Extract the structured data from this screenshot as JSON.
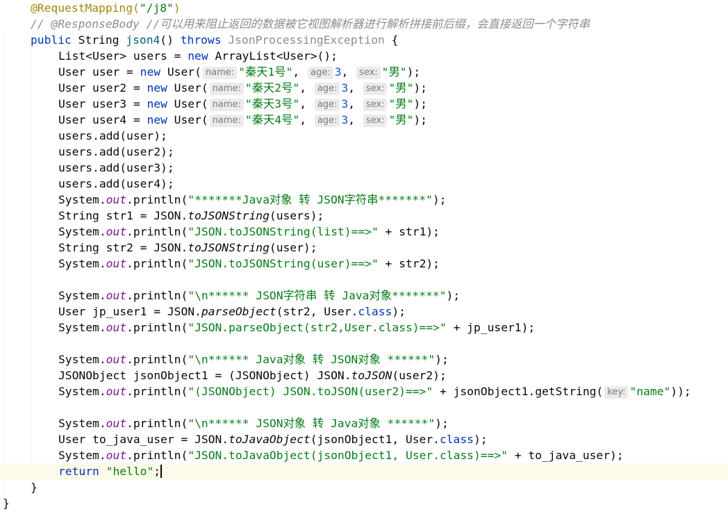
{
  "colors": {
    "keyword": "#0033b3",
    "string": "#067d17",
    "number": "#1750eb",
    "annotation": "#9e880d",
    "comment": "#8c8c8c",
    "static_field": "#871094",
    "method_name": "#00627a",
    "current_line": "#fcfae9",
    "hint_bg": "#ebebeb"
  },
  "code": {
    "l1": {
      "ann": "@RequestMapping(",
      "str": "\"/j8\"",
      "close": ")"
    },
    "l2": {
      "comment": "// @ResponseBody //可以用来阻止返回的数据被它视图解析器进行解析拼接前后缀，会直接返回一个字符串"
    },
    "l3": {
      "kw1": "public",
      "type": "String",
      "name": "json4",
      "parens": "()",
      "kw2": "throws",
      "exc": "JsonProcessingException",
      "brace": "{"
    },
    "l4": {
      "text1": "List<User> users = ",
      "kw": "new",
      "text2": " ArrayList<User>();"
    },
    "l5": {
      "prefix": "User user = ",
      "kw": "new",
      "ctor": " User(",
      "hint_name": "name:",
      "str_name": "\"秦天1号\"",
      "hint_age": "age:",
      "age": "3",
      "hint_sex": "sex:",
      "str_sex": "\"男\"",
      "end": ");"
    },
    "l6": {
      "prefix": "User user2 = ",
      "kw": "new",
      "ctor": " User(",
      "hint_name": "name:",
      "str_name": "\"秦天2号\"",
      "hint_age": "age:",
      "age": "3",
      "hint_sex": "sex:",
      "str_sex": "\"男\"",
      "end": ");"
    },
    "l7": {
      "prefix": "User user3 = ",
      "kw": "new",
      "ctor": " User(",
      "hint_name": "name:",
      "str_name": "\"秦天3号\"",
      "hint_age": "age:",
      "age": "3",
      "hint_sex": "sex:",
      "str_sex": "\"男\"",
      "end": ");"
    },
    "l8": {
      "prefix": "User user4 = ",
      "kw": "new",
      "ctor": " User(",
      "hint_name": "name:",
      "str_name": "\"秦天4号\"",
      "hint_age": "age:",
      "age": "3",
      "hint_sex": "sex:",
      "str_sex": "\"男\"",
      "end": ");"
    },
    "l9": {
      "text": "users.add(user);"
    },
    "l10": {
      "text": "users.add(user2);"
    },
    "l11": {
      "text": "users.add(user3);"
    },
    "l12": {
      "text": "users.add(user4);"
    },
    "l13": {
      "sys": "System.",
      "out": "out",
      "println": ".println(",
      "str": "\"*******Java对象 转 JSON字符串*******\"",
      "end": ");"
    },
    "l14": {
      "prefix": "String str1 = JSON.",
      "method": "toJSONString",
      "end": "(users);"
    },
    "l15": {
      "sys": "System.",
      "out": "out",
      "println": ".println(",
      "str": "\"JSON.toJSONString(list)==>\"",
      "end": " + str1);"
    },
    "l16": {
      "prefix": "String str2 = JSON.",
      "method": "toJSONString",
      "end": "(user);"
    },
    "l17": {
      "sys": "System.",
      "out": "out",
      "println": ".println(",
      "str": "\"JSON.toJSONString(user)==>\"",
      "end": " + str2);"
    },
    "l19": {
      "sys": "System.",
      "out": "out",
      "println": ".println(",
      "str": "\"\\n****** JSON字符串 转 Java对象*******\"",
      "end": ");"
    },
    "l20": {
      "prefix": "User jp_user1 = JSON.",
      "method": "parseObject",
      "mid": "(str2, User.",
      "kw": "class",
      "end": ");"
    },
    "l21": {
      "sys": "System.",
      "out": "out",
      "println": ".println(",
      "str": "\"JSON.parseObject(str2,User.class)==>\"",
      "end": " + jp_user1);"
    },
    "l23": {
      "sys": "System.",
      "out": "out",
      "println": ".println(",
      "str": "\"\\n****** Java对象 转 JSON对象 ******\"",
      "end": ");"
    },
    "l24": {
      "prefix": "JSONObject jsonObject1 = (JSONObject) JSON.",
      "method": "toJSON",
      "end": "(user2);"
    },
    "l25": {
      "sys": "System.",
      "out": "out",
      "println": ".println(",
      "str": "\"(JSONObject) JSON.toJSON(user2)==>\"",
      "mid": " + jsonObject1.getString(",
      "hint_key": "key:",
      "str2": "\"name\"",
      "end": "));"
    },
    "l27": {
      "sys": "System.",
      "out": "out",
      "println": ".println(",
      "str": "\"\\n****** JSON对象 转 Java对象 ******\"",
      "end": ");"
    },
    "l28": {
      "prefix": "User to_java_user = JSON.",
      "method": "toJavaObject",
      "mid": "(jsonObject1, User.",
      "kw": "class",
      "end": ");"
    },
    "l29": {
      "sys": "System.",
      "out": "out",
      "println": ".println(",
      "str": "\"JSON.toJavaObject(jsonObject1, User.class)==>\"",
      "end": " + to_java_user);"
    },
    "l30": {
      "kw": "return",
      "str": "\"hello\"",
      "end": ";"
    },
    "l31": {
      "brace": "}"
    },
    "l32": {
      "brace": "}"
    }
  }
}
